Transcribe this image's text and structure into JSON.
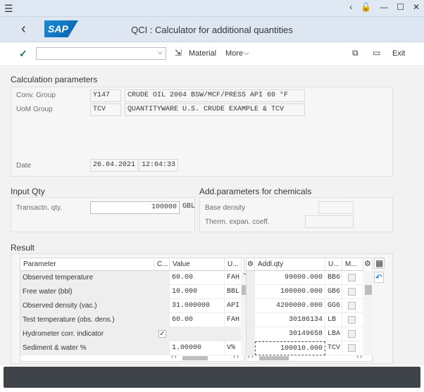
{
  "app": {
    "title": "QCI : Calculator for additional quantities",
    "logo": "SAP"
  },
  "toolbar": {
    "material_label": "Material",
    "more_label": "More",
    "exit_label": "Exit"
  },
  "calc": {
    "heading": "Calculation parameters",
    "conv_group_label": "Conv. Group",
    "conv_group_value": "Y147",
    "conv_group_desc": "CRUDE OIL 2004 BSW/MCF/PRESS API 60 °F",
    "uom_group_label": "UoM Group",
    "uom_group_value": "TCV",
    "uom_group_desc": "QUANTITYWARE U.S. CRUDE EXAMPLE & TCV",
    "date_label": "Date",
    "date_value": "26.04.2021",
    "time_value": "12:04:33"
  },
  "input": {
    "heading": "Input Qty",
    "qty_label": "Transactn. qty.",
    "qty_value": "100000",
    "qty_unit": "GBL"
  },
  "chem": {
    "heading": "Add.parameters for chemicals",
    "base_density_label": "Base density",
    "therm_label": "Therm. expan. coeff."
  },
  "result": {
    "heading": "Result",
    "left_headers": [
      "Parameter",
      "C...",
      "Value",
      "U..."
    ],
    "right_headers": [
      "Addl.qty",
      "U...",
      "M..."
    ],
    "left_rows": [
      {
        "param": "Observed temperature",
        "value": "60.00",
        "unit": "FAH"
      },
      {
        "param": "Free water (bbl)",
        "value": "10.000",
        "unit": "BBL"
      },
      {
        "param": "Observed density (vac.)",
        "value": "31.000000",
        "unit": "API"
      },
      {
        "param": "Test temperature (obs. dens.)",
        "value": "60.00",
        "unit": "FAH"
      },
      {
        "param": "Hydrometer corr. indicator",
        "value": "",
        "unit": ""
      },
      {
        "param": "Sediment & water %",
        "value": "1.00000",
        "unit": "V%"
      }
    ],
    "right_rows": [
      {
        "qty": "99000.000",
        "unit": "BB6"
      },
      {
        "qty": "100000.000",
        "unit": "GB6"
      },
      {
        "qty": "4200000.000",
        "unit": "GG6"
      },
      {
        "qty": "30186134",
        "unit": "LB"
      },
      {
        "qty": "30149658",
        "unit": "LBA"
      },
      {
        "qty": "100010.000",
        "unit": "TCV"
      }
    ]
  }
}
